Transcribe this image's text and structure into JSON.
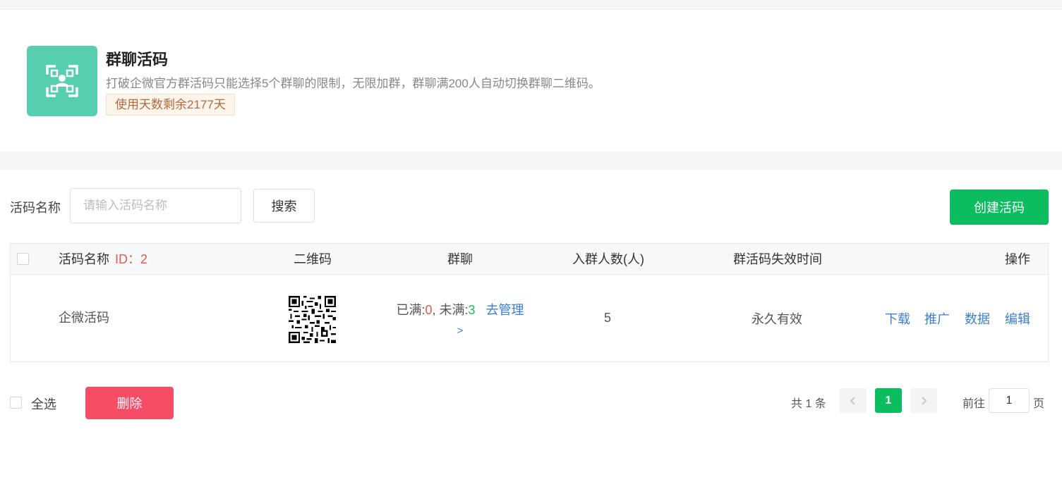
{
  "header": {
    "icon": "qr-scan-person-icon",
    "title": "群聊活码",
    "description": "打破企微官方群活码只能选择5个群聊的限制，无限加群，群聊满200人自动切换群聊二维码。",
    "days_badge": "使用天数剩余2177天"
  },
  "colors": {
    "accent": "#0bbd5e",
    "icon_bg": "#56cfb0",
    "danger": "#f54d66",
    "link": "#3a7fd6",
    "id_red": "#e8594c"
  },
  "search": {
    "label": "活码名称",
    "placeholder": "请输入活码名称",
    "value": "",
    "button": "搜索"
  },
  "create_button": "创建活码",
  "table": {
    "headers": {
      "name": "活码名称",
      "id": "ID：2",
      "qrcode": "二维码",
      "group": "群聊",
      "members": "入群人数(人)",
      "expire": "群活码失效时间",
      "actions": "操作"
    },
    "rows": [
      {
        "name": "企微活码",
        "group_full_label": "已满:",
        "group_full_count": "0",
        "group_sep": ", 未满:",
        "group_notfull_count": "3",
        "manage_link": "去管理",
        "manage_arrow": ">",
        "members": "5",
        "expire": "永久有效",
        "actions": [
          "下载",
          "推广",
          "数据",
          "编辑"
        ]
      }
    ]
  },
  "footer": {
    "select_all": "全选",
    "delete_button": "删除"
  },
  "pagination": {
    "total": "共 1 条",
    "prev_icon": "chevron-left-icon",
    "next_icon": "chevron-right-icon",
    "current_page": "1",
    "goto_label": "前往",
    "goto_value": "1",
    "page_suffix": "页"
  }
}
